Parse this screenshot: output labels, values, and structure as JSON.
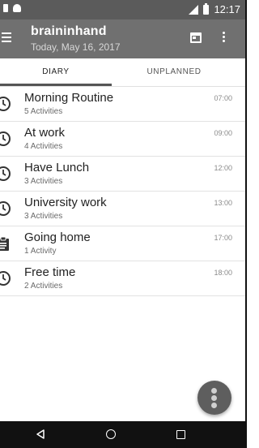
{
  "status_bar": {
    "time": "12:17"
  },
  "app_bar": {
    "title": "braininhand",
    "subtitle": "Today, May 16, 2017",
    "icons": [
      "menu-icon",
      "calendar-icon",
      "more-vert-icon"
    ]
  },
  "tabs": [
    {
      "label": "DIARY",
      "selected": true
    },
    {
      "label": "UNPLANNED",
      "selected": false
    }
  ],
  "activities": [
    {
      "title": "Morning Routine",
      "count": "5 Activities",
      "time": "07:00",
      "icon": "clock-icon"
    },
    {
      "title": "At work",
      "count": "4 Activities",
      "time": "09:00",
      "icon": "clock-icon"
    },
    {
      "title": "Have Lunch",
      "count": "3 Activities",
      "time": "12:00",
      "icon": "clock-icon"
    },
    {
      "title": "University work",
      "count": "3 Activities",
      "time": "13:00",
      "icon": "clock-icon"
    },
    {
      "title": "Going home",
      "count": "1 Activity",
      "time": "17:00",
      "icon": "clipboard-icon"
    },
    {
      "title": "Free time",
      "count": "2 Activities",
      "time": "18:00",
      "icon": "clock-icon"
    }
  ],
  "fab": {
    "icon": "traffic-light-icon"
  },
  "nav_bar": {
    "icons": [
      "back-icon",
      "home-icon",
      "recents-icon"
    ]
  },
  "colors": {
    "app_bar": "#707070",
    "status_bar": "#5b5b5b",
    "nav_bar": "#111111",
    "fab": "#5e5e5e"
  }
}
